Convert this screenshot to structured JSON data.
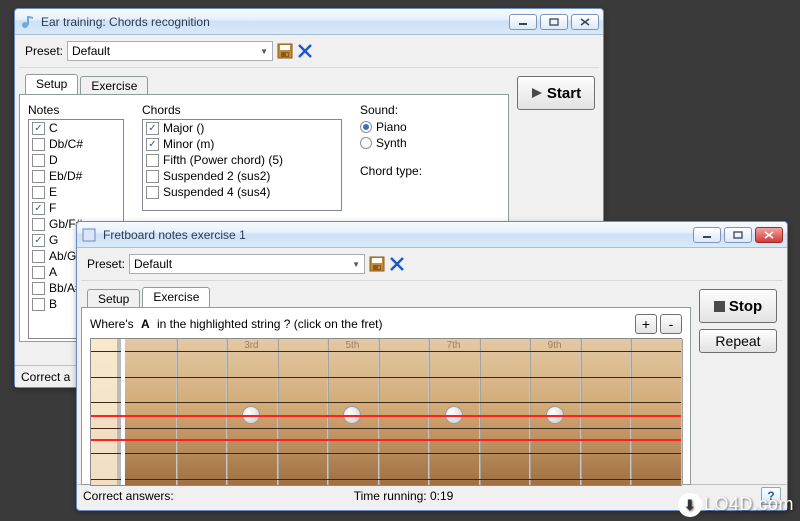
{
  "window1": {
    "title": "Ear training: Chords recognition",
    "preset_label": "Preset:",
    "preset_value": "Default",
    "tabs": {
      "setup": "Setup",
      "exercise": "Exercise"
    },
    "notes_label": "Notes",
    "chords_label": "Chords",
    "sound_label": "Sound:",
    "chordtype_label": "Chord type:",
    "notes": [
      {
        "label": "C",
        "checked": true
      },
      {
        "label": "Db/C#",
        "checked": false
      },
      {
        "label": "D",
        "checked": false
      },
      {
        "label": "Eb/D#",
        "checked": false
      },
      {
        "label": "E",
        "checked": false
      },
      {
        "label": "F",
        "checked": true
      },
      {
        "label": "Gb/F#",
        "checked": false
      },
      {
        "label": "G",
        "checked": true
      },
      {
        "label": "Ab/G#",
        "checked": false
      },
      {
        "label": "A",
        "checked": false
      },
      {
        "label": "Bb/A#",
        "checked": false
      },
      {
        "label": "B",
        "checked": false
      }
    ],
    "chords": [
      {
        "label": "Major ()",
        "checked": true
      },
      {
        "label": "Minor (m)",
        "checked": true
      },
      {
        "label": "Fifth (Power chord) (5)",
        "checked": false
      },
      {
        "label": "Suspended 2 (sus2)",
        "checked": false
      },
      {
        "label": "Suspended 4 (sus4)",
        "checked": false
      }
    ],
    "sound_options": [
      {
        "label": "Piano",
        "checked": true
      },
      {
        "label": "Synth",
        "checked": false
      }
    ],
    "start_label": "Start",
    "status_left": "Correct a"
  },
  "window2": {
    "title": "Fretboard notes exercise 1",
    "preset_label": "Preset:",
    "preset_value": "Default",
    "tabs": {
      "setup": "Setup",
      "exercise": "Exercise"
    },
    "question_prefix": "Where's",
    "question_note": "A",
    "question_suffix": "in the highlighted string ? (click on the fret)",
    "stop_label": "Stop",
    "repeat_label": "Repeat",
    "plus_label": "+",
    "minus_label": "-",
    "fret_labels": [
      {
        "text": "3rd",
        "fret": 3
      },
      {
        "text": "5th",
        "fret": 5
      },
      {
        "text": "7th",
        "fret": 7
      },
      {
        "text": "9th",
        "fret": 9
      }
    ],
    "fret_markers": [
      3,
      5,
      7,
      9
    ],
    "fret_count": 11,
    "string_count": 6,
    "highlighted_string_index": 3,
    "status": {
      "correct_label": "Correct answers:",
      "correct_value": "",
      "time_label": "Time running:",
      "time_value": "0:19"
    },
    "help_label": "?"
  },
  "watermark": "LO4D.com"
}
